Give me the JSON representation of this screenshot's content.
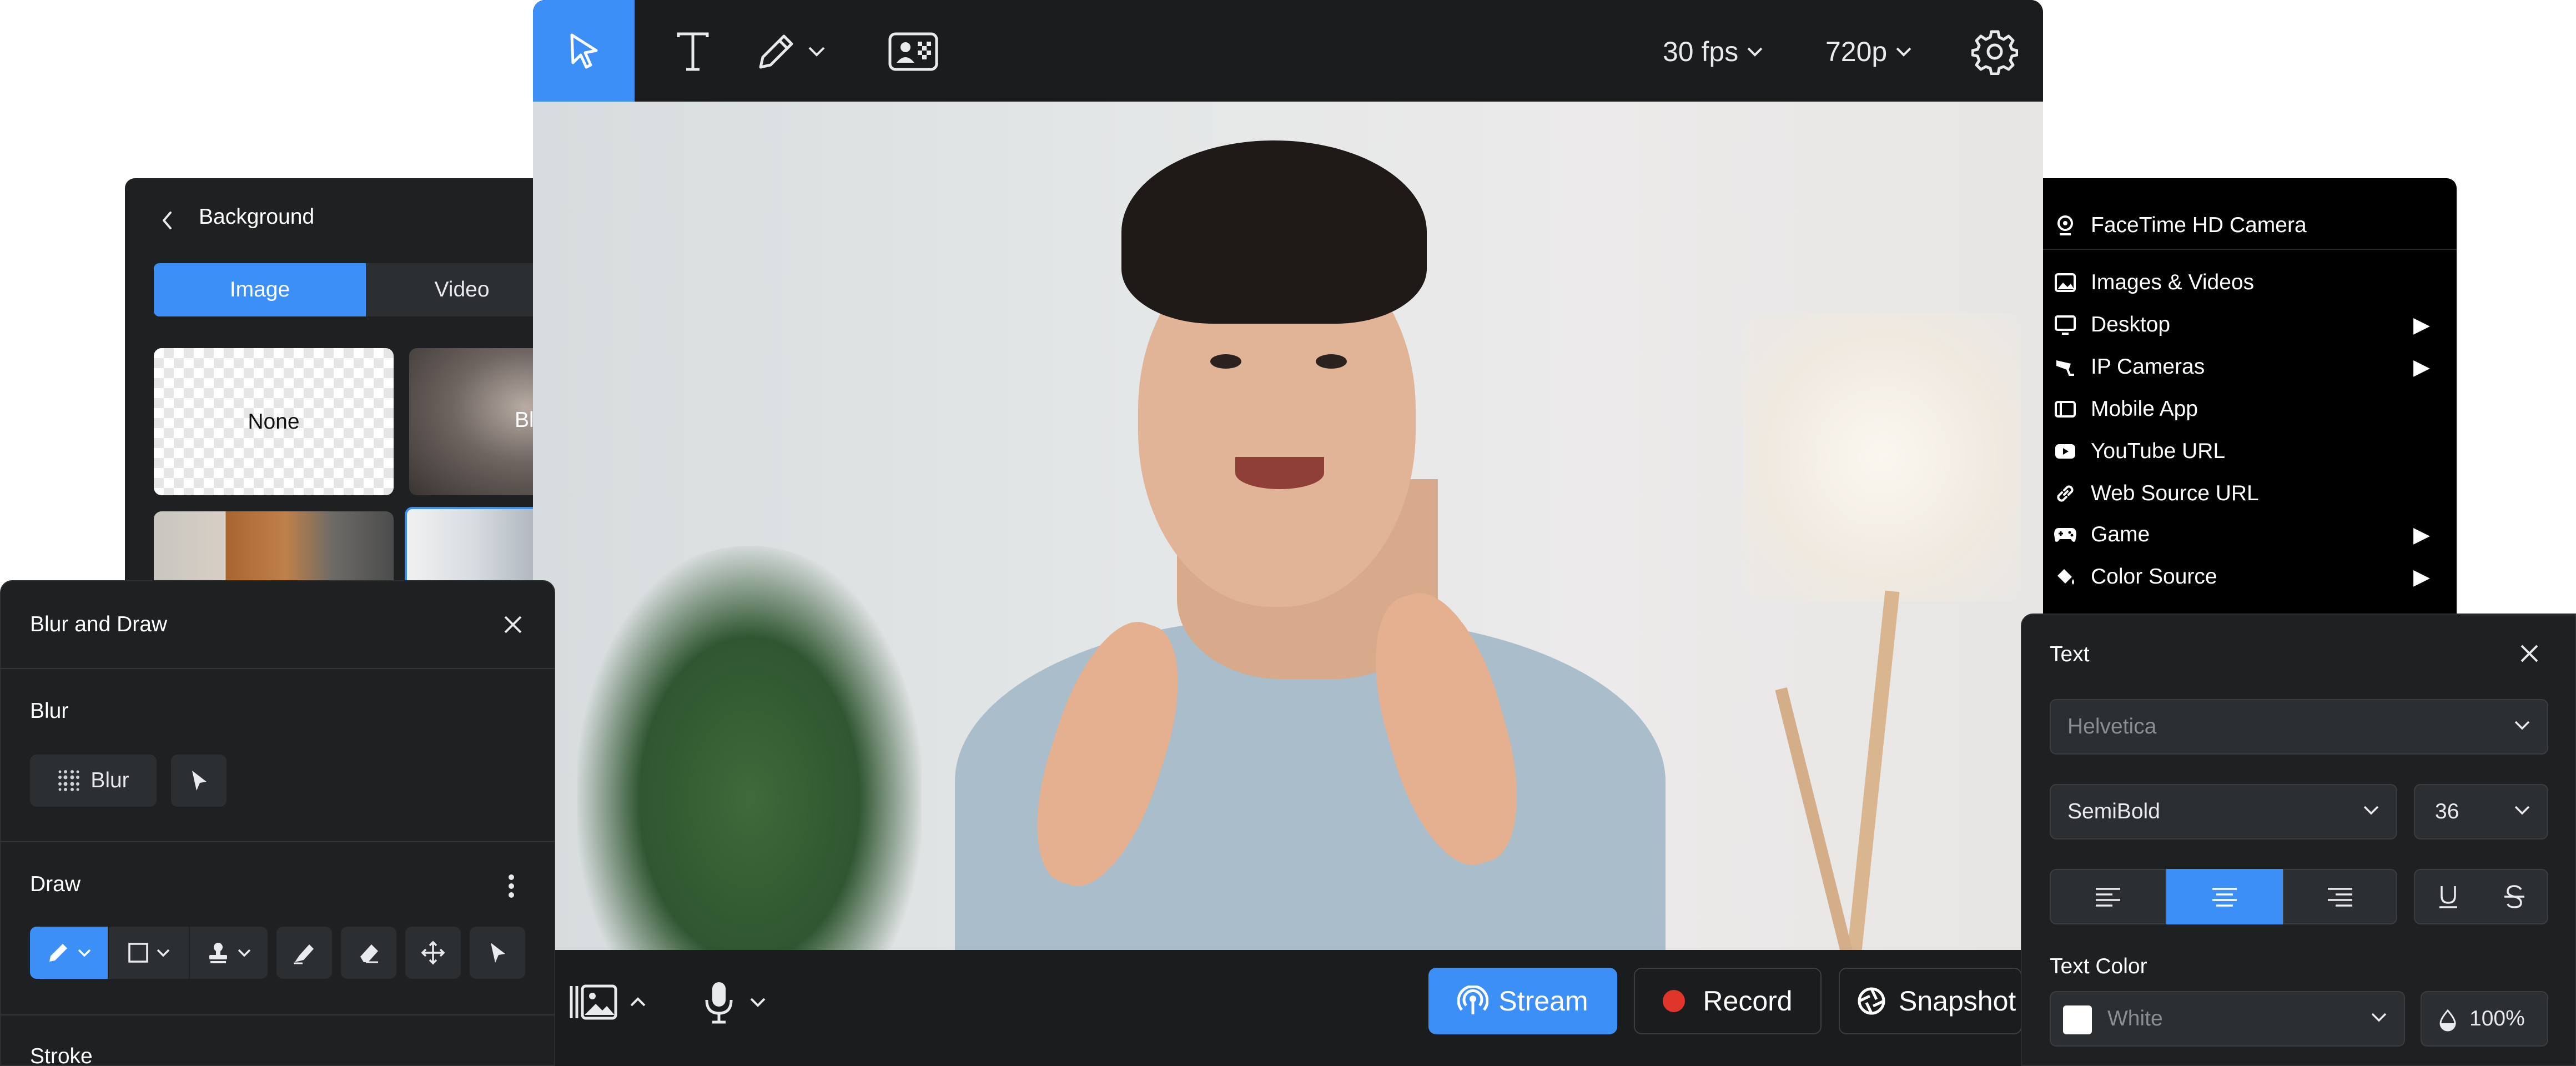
{
  "toolbar": {
    "fps": "30 fps",
    "resolution": "720p",
    "accent": "#3d8ff8"
  },
  "bottombar": {
    "stream": "Stream",
    "record": "Record",
    "snapshot": "Snapshot"
  },
  "background_panel": {
    "title": "Background",
    "tabs": [
      "Image",
      "Video"
    ],
    "tiles": [
      "None",
      "Bl"
    ]
  },
  "source_menu": {
    "camera": "FaceTime HD Camera",
    "items": [
      {
        "label": "Images & Videos",
        "icon": "image-icon",
        "submenu": false
      },
      {
        "label": "Desktop",
        "icon": "monitor-icon",
        "submenu": true
      },
      {
        "label": "IP Cameras",
        "icon": "security-camera-icon",
        "submenu": true
      },
      {
        "label": "Mobile App",
        "icon": "mobile-icon",
        "submenu": false
      },
      {
        "label": "YouTube URL",
        "icon": "youtube-icon",
        "submenu": false
      },
      {
        "label": "Web Source URL",
        "icon": "link-icon",
        "submenu": false
      },
      {
        "label": "Game",
        "icon": "gamepad-icon",
        "submenu": true
      },
      {
        "label": "Color Source",
        "icon": "paint-bucket-icon",
        "submenu": true
      }
    ]
  },
  "blur_panel": {
    "title": "Blur and Draw",
    "blur_section": "Blur",
    "blur_button": "Blur",
    "draw_section": "Draw",
    "stroke_section": "Stroke"
  },
  "text_panel": {
    "title": "Text",
    "font": "Helvetica",
    "weight": "SemiBold",
    "size": "36",
    "text_color_label": "Text Color",
    "color_value": "White",
    "opacity": "100%"
  },
  "colors": {
    "panel_bg": "#1e2022",
    "control_bg": "#2c2f32",
    "record_red": "#e0352b"
  }
}
